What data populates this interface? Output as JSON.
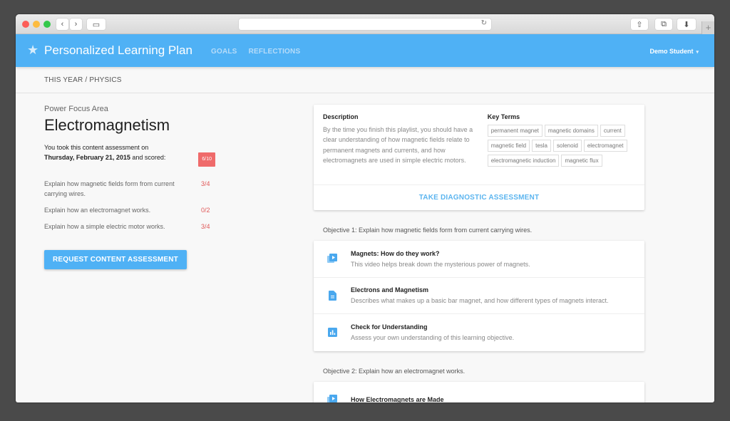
{
  "browser": {
    "back_icon": "‹",
    "forward_icon": "›",
    "sidebar_icon": "▭",
    "reload_icon": "↻",
    "share_icon": "⇧",
    "tabs_icon": "⧉",
    "download_icon": "⬇",
    "new_tab_icon": "+"
  },
  "app": {
    "logo_icon": "★",
    "title": "Personalized Learning Plan",
    "nav": [
      {
        "label": "GOALS"
      },
      {
        "label": "REFLECTIONS"
      }
    ],
    "user": "Demo Student",
    "user_caret": "▾",
    "brand_color": "#4fb1f5"
  },
  "breadcrumb": "THIS YEAR / PHYSICS",
  "focus": {
    "kicker": "Power Focus Area",
    "title": "Electromagnetism",
    "took_prefix": "You took this content assessment on",
    "date": "Thursday, February 21, 2015",
    "took_suffix": " and scored:",
    "score": "6/10",
    "objectives": [
      {
        "text": "Explain how magnetic fields form from current carrying wires.",
        "score": "3/4"
      },
      {
        "text": "Explain how an electromagnet works.",
        "score": "0/2"
      },
      {
        "text": "Explain how a simple electric motor works.",
        "score": "3/4"
      }
    ],
    "request_button": "REQUEST CONTENT ASSESSMENT"
  },
  "playlist": {
    "description_heading": "Description",
    "description": "By the time you finish this playlist, you should have a clear understanding of how magnetic fields relate to permanent magnets and currents, and how electromagnets are used in simple electric motors.",
    "key_terms_heading": "Key Terms",
    "key_terms": [
      "permanent magnet",
      "magnetic domains",
      "current",
      "magnetic field",
      "tesla",
      "solenoid",
      "electromagnet",
      "electromagnetic induction",
      "magnetic flux"
    ],
    "diagnostic_button": "TAKE DIAGNOSTIC ASSESSMENT"
  },
  "objectives": [
    {
      "heading": "Objective 1: Explain how magnetic fields form from current carrying wires.",
      "items": [
        {
          "icon": "video-library-icon",
          "title": "Magnets: How do they work?",
          "subtitle": "This video helps break down the mysterious power of magnets."
        },
        {
          "icon": "document-icon",
          "title": "Electrons and Magnetism",
          "subtitle": "Describes what makes up a basic bar magnet, and how different types of magnets interact."
        },
        {
          "icon": "chart-icon",
          "title": "Check for Understanding",
          "subtitle": "Assess your own understanding of this learning objective."
        }
      ]
    },
    {
      "heading": "Objective 2: Explain how an electromagnet works.",
      "items": [
        {
          "icon": "video-library-icon",
          "title": "How Electromagnets are Made",
          "subtitle": ""
        }
      ]
    }
  ]
}
